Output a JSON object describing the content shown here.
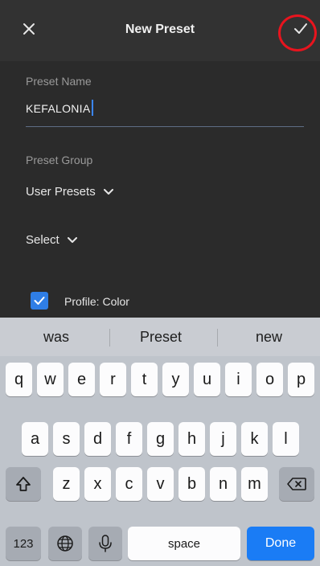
{
  "header": {
    "title": "New Preset",
    "close_icon": "close-icon",
    "confirm_icon": "checkmark-icon",
    "highlight_color": "#e8141e"
  },
  "form": {
    "preset_name_label": "Preset Name",
    "preset_name_value": "KEFALONIA",
    "preset_group_label": "Preset Group",
    "preset_group_value": "User Presets",
    "select_label": "Select",
    "profile_checkbox_label": "Profile: Color",
    "profile_checked": true,
    "accent_color": "#2f7ee6"
  },
  "keyboard": {
    "suggestions": [
      "was",
      "Preset",
      "new"
    ],
    "row1": [
      "q",
      "w",
      "e",
      "r",
      "t",
      "y",
      "u",
      "i",
      "o",
      "p"
    ],
    "row2": [
      "a",
      "s",
      "d",
      "f",
      "g",
      "h",
      "j",
      "k",
      "l"
    ],
    "row3": [
      "z",
      "x",
      "c",
      "v",
      "b",
      "n",
      "m"
    ],
    "numbers_key": "123",
    "space_key": "space",
    "done_key": "Done",
    "shift_icon": "shift-icon",
    "backspace_icon": "backspace-icon",
    "globe_icon": "globe-icon",
    "mic_icon": "microphone-icon"
  }
}
